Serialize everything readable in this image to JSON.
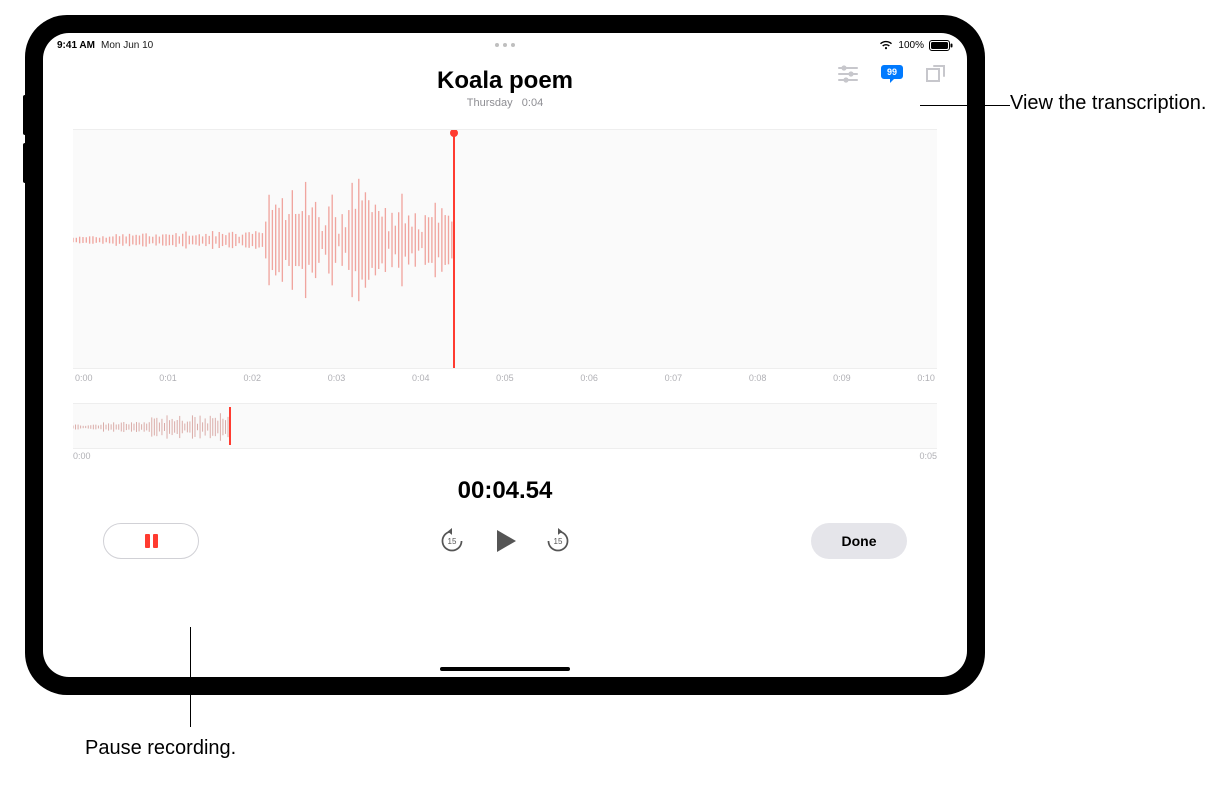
{
  "status": {
    "time": "9:41 AM",
    "date": "Mon Jun 10",
    "battery_pct": "100%"
  },
  "title": "Koala poem",
  "subtitle_day": "Thursday",
  "subtitle_duration": "0:04",
  "ruler": [
    "0:00",
    "0:01",
    "0:02",
    "0:03",
    "0:04",
    "0:05",
    "0:06",
    "0:07",
    "0:08",
    "0:09",
    "0:10"
  ],
  "overview": {
    "start": "0:00",
    "end": "0:05"
  },
  "timer": "00:04.54",
  "skip_seconds": "15",
  "done_label": "Done",
  "accent_color": "#ff3b30",
  "blue_accent": "#007aff",
  "callouts": {
    "transcription": "View the transcription.",
    "pause": "Pause recording."
  }
}
